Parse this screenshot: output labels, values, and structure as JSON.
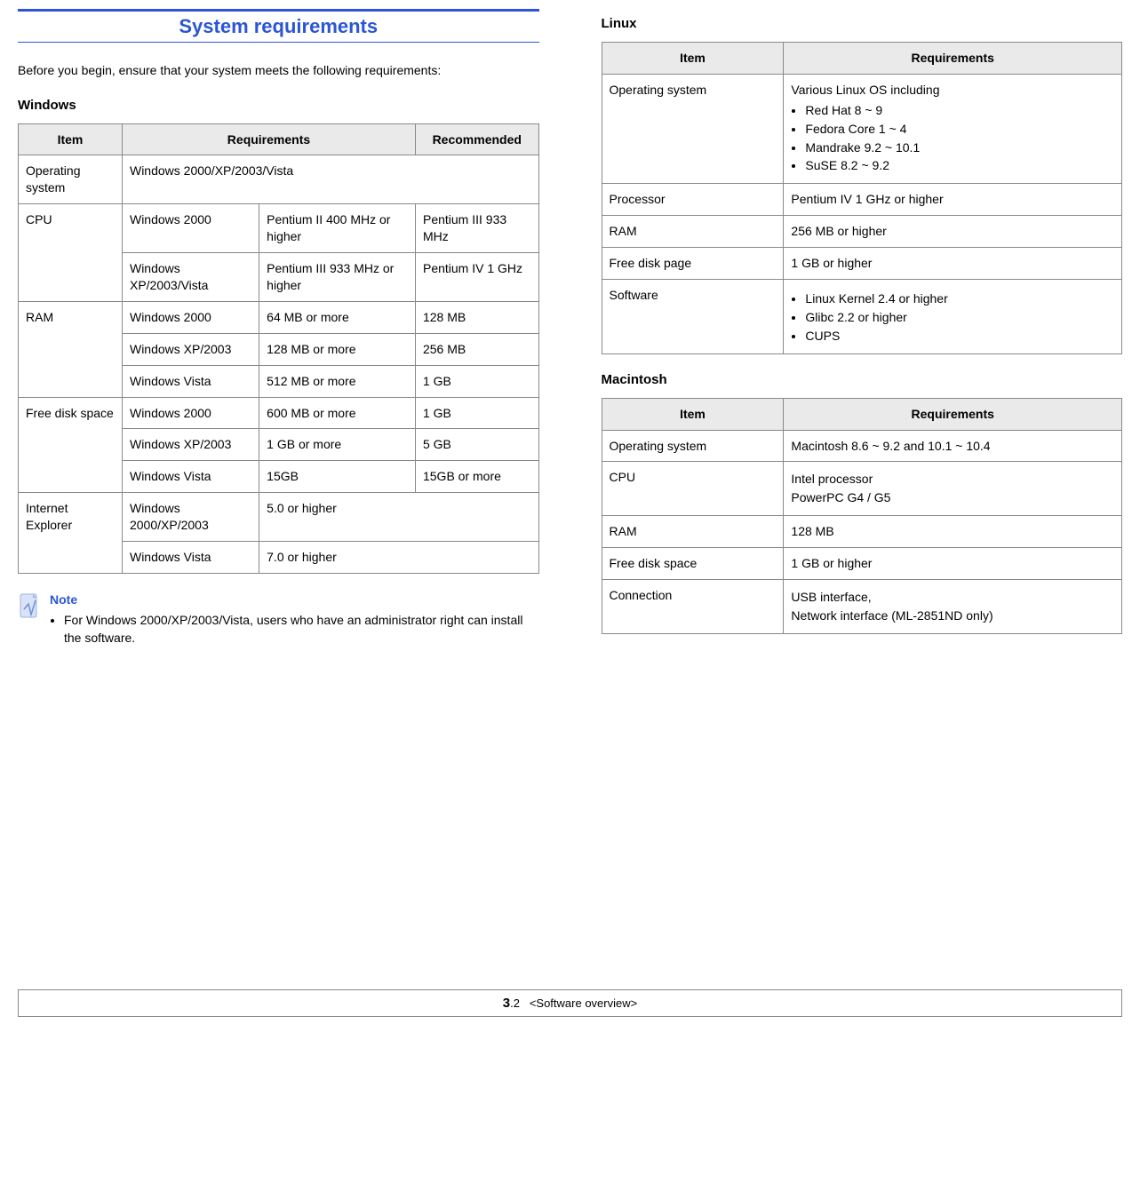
{
  "title": "System requirements",
  "intro": "Before you begin, ensure that your system meets the following requirements:",
  "windows": {
    "heading": "Windows",
    "headers": {
      "item": "Item",
      "req": "Requirements",
      "rec": "Recommended"
    },
    "rows": {
      "os_item": "Operating system",
      "os_req": "Windows 2000/XP/2003/Vista",
      "cpu_item": "CPU",
      "cpu_r1_os": "Windows 2000",
      "cpu_r1_req": "Pentium II 400 MHz or higher",
      "cpu_r1_rec": "Pentium III 933 MHz",
      "cpu_r2_os": "Windows XP/2003/Vista",
      "cpu_r2_req": "Pentium III 933 MHz or higher",
      "cpu_r2_rec": "Pentium IV 1 GHz",
      "ram_item": "RAM",
      "ram_r1_os": "Windows 2000",
      "ram_r1_req": "64 MB or more",
      "ram_r1_rec": "128 MB",
      "ram_r2_os": "Windows XP/2003",
      "ram_r2_req": "128 MB or more",
      "ram_r2_rec": "256 MB",
      "ram_r3_os": "Windows Vista",
      "ram_r3_req": "512 MB or more",
      "ram_r3_rec": "1 GB",
      "disk_item": "Free disk space",
      "disk_r1_os": "Windows 2000",
      "disk_r1_req": "600 MB or more",
      "disk_r1_rec": "1 GB",
      "disk_r2_os": "Windows XP/2003",
      "disk_r2_req": "1 GB or more",
      "disk_r2_rec": "5 GB",
      "disk_r3_os": "Windows Vista",
      "disk_r3_req": "15GB",
      "disk_r3_rec": "15GB or more",
      "ie_item": "Internet Explorer",
      "ie_r1_os": "Windows 2000/XP/2003",
      "ie_r1_req": "5.0 or higher",
      "ie_r2_os": "Windows Vista",
      "ie_r2_req": "7.0 or higher"
    }
  },
  "note": {
    "title": "Note",
    "bullet": "For Windows 2000/XP/2003/Vista, users who have an administrator right can install the software."
  },
  "linux": {
    "heading": "Linux",
    "headers": {
      "item": "Item",
      "req": "Requirements"
    },
    "os_item": "Operating system",
    "os_intro": "Various Linux OS including",
    "os_list": [
      "Red Hat 8 ~ 9",
      "Fedora Core 1 ~ 4",
      "Mandrake 9.2 ~ 10.1",
      "SuSE 8.2 ~ 9.2"
    ],
    "proc_item": "Processor",
    "proc_req": "Pentium IV 1 GHz or higher",
    "ram_item": "RAM",
    "ram_req": "256 MB or higher",
    "disk_item": "Free disk page",
    "disk_req": "1 GB or higher",
    "sw_item": "Software",
    "sw_list": [
      "Linux Kernel 2.4 or higher",
      "Glibc 2.2 or higher",
      "CUPS"
    ]
  },
  "mac": {
    "heading": "Macintosh",
    "headers": {
      "item": "Item",
      "req": "Requirements"
    },
    "os_item": "Operating system",
    "os_req": "Macintosh 8.6 ~ 9.2 and 10.1 ~ 10.4",
    "cpu_item": "CPU",
    "cpu_req1": "Intel processor",
    "cpu_req2": "PowerPC G4 / G5",
    "ram_item": "RAM",
    "ram_req": "128 MB",
    "disk_item": "Free disk space",
    "disk_req": "1 GB or higher",
    "conn_item": "Connection",
    "conn_req1": "USB interface,",
    "conn_req2": "Network interface (ML-2851ND only)"
  },
  "footer": {
    "chapter": "3",
    "page": ".2",
    "label": "<Software overview>"
  }
}
